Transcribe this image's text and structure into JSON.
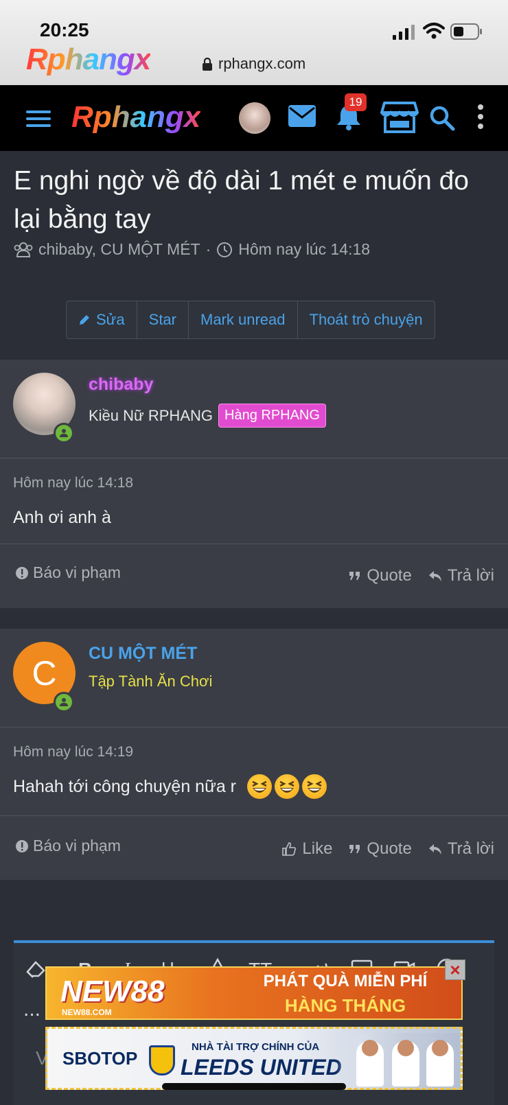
{
  "status_bar": {
    "time": "20:25",
    "logo_text": "Rphangx",
    "url": "rphangx.com"
  },
  "navbar": {
    "logo_text": "Rphangx",
    "notification_count": "19",
    "icons": [
      "menu-icon",
      "avatar",
      "mail-icon",
      "bell-icon",
      "store-icon",
      "search-icon",
      "more-icon"
    ],
    "accent_color": "#4aa3ea"
  },
  "thread": {
    "title": "E nghi ngờ về độ dài 1 mét e muốn đo lại bằng tay",
    "participants": "chibaby, CU MỘT MÉT",
    "separator": "·",
    "time": "Hôm nay lúc 14:18",
    "actions": [
      "Sửa",
      "Star",
      "Mark unread",
      "Thoát trò chuyện"
    ]
  },
  "posts": [
    {
      "username": "chibaby",
      "username_color": "#d76bf0",
      "user_title": "Kiều Nữ RPHANG",
      "rank_badge": "Hàng RPHANG",
      "date": "Hôm nay lúc 14:18",
      "body": "Anh ơi anh à",
      "report": "Báo vi phạm",
      "quote": "Quote",
      "reply": "Trả lời"
    },
    {
      "username": "CU MỘT MÉT",
      "username_color": "#4aa3ea",
      "avatar_letter": "C",
      "avatar_color": "#f08a1e",
      "user_title": "Tập Tành Ăn Chơi",
      "user_title_color": "#e6e04a",
      "date": "Hôm nay lúc 14:19",
      "body": "Hahah tới công chuyện nữa r",
      "emoji_count": 3,
      "report": "Báo vi phạm",
      "like": "Like",
      "quote": "Quote",
      "reply": "Trả lời"
    }
  ],
  "editor": {
    "more": "...",
    "placeholder": "V"
  },
  "ads": {
    "ad1": {
      "logo": "NEW88",
      "logo_sub": "NEW88.COM",
      "line1": "PHÁT QUÀ MIỄN PHÍ",
      "line2": "HÀNG THÁNG",
      "close": "×"
    },
    "ad2": {
      "brand": "SBOTOP",
      "line1": "NHÀ TÀI TRỢ CHÍNH CỦA",
      "line2": "LEEDS UNITED"
    }
  }
}
